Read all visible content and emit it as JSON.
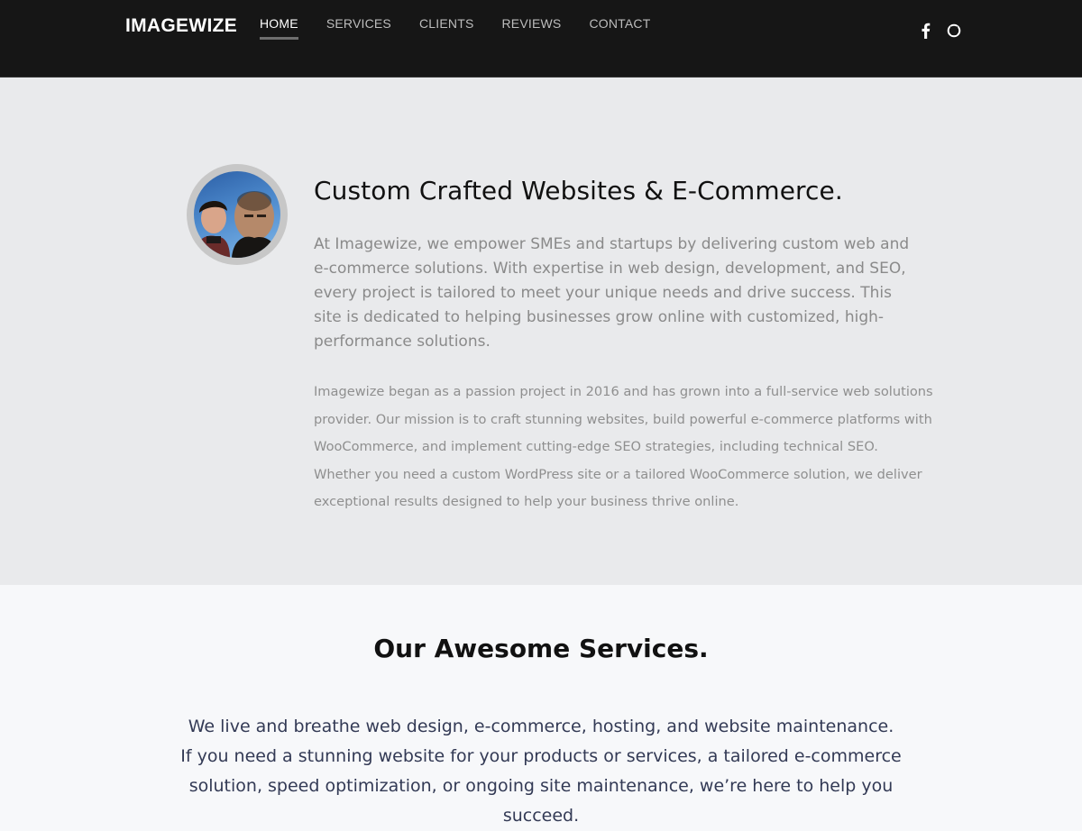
{
  "header": {
    "logo": "IMAGEWIZE",
    "nav": [
      {
        "label": "HOME",
        "active": true
      },
      {
        "label": "SERVICES",
        "active": false
      },
      {
        "label": "CLIENTS",
        "active": false
      },
      {
        "label": "REVIEWS",
        "active": false
      },
      {
        "label": "CONTACT",
        "active": false
      }
    ],
    "social_icons": [
      "facebook-icon",
      "github-icon"
    ]
  },
  "hero": {
    "title": "Custom Crafted Websites & E-Commerce.",
    "lead": "At Imagewize, we empower SMEs and startups by delivering custom web and e-commerce solutions. With expertise in web design, development, and SEO, every project is tailored to meet your unique needs and drive success. This site is dedicated to helping businesses grow online with customized, high-performance solutions.",
    "body": "Imagewize began as a passion project in 2016 and has grown into a full-service web solutions provider. Our mission is to craft stunning websites, build powerful e-commerce platforms with WooCommerce, and implement cutting-edge SEO strategies, including technical SEO. Whether you need a custom WordPress site or a tailored WooCommerce solution, we deliver exceptional results designed to help your business thrive online."
  },
  "services": {
    "title": "Our Awesome Services.",
    "text": "We live and breathe web design, e-commerce, hosting, and website maintenance. If you need a stunning website for your products or services, a tailored e-commerce solution, speed optimization, or ongoing site maintenance, we’re here to help you succeed."
  },
  "colors": {
    "topbar": "#161616",
    "hero_bg": "#e9eaec",
    "services_bg": "#f7f8fa",
    "muted_text": "#8a8a8a",
    "services_text": "#333a55"
  }
}
